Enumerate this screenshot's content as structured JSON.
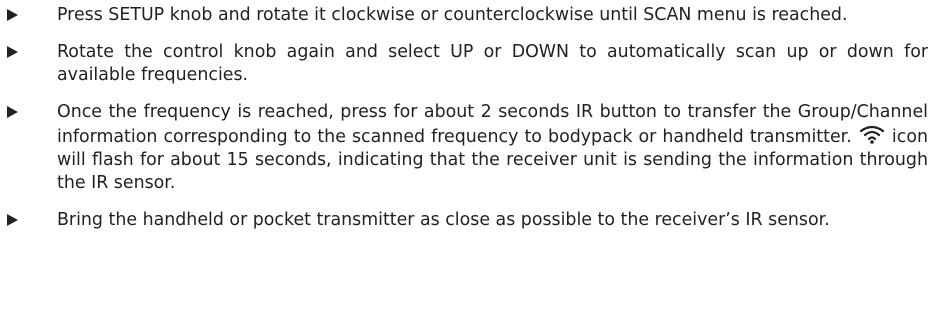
{
  "instructions": [
    {
      "text": "Press SETUP knob and rotate it clockwise or counterclockwise until SCAN menu is reached."
    },
    {
      "text": "Rotate the control knob again and select UP or DOWN to automatically scan up or down for available frequencies."
    },
    {
      "text_before_icon": "Once the frequency is reached, press for about 2 seconds IR button to transfer the Group/Channel information corresponding to the scanned frequency to bodypack or handheld transmitter. ",
      "icon": "wifi-icon",
      "text_after_icon": " icon will flash for about 15 seconds, indicating that the receiver unit is sending the information through the IR sensor."
    },
    {
      "text": "Bring the handheld or pocket transmitter as close as possible to the receiver’s IR sensor."
    }
  ],
  "colors": {
    "text": "#222222",
    "background": "#ffffff"
  }
}
